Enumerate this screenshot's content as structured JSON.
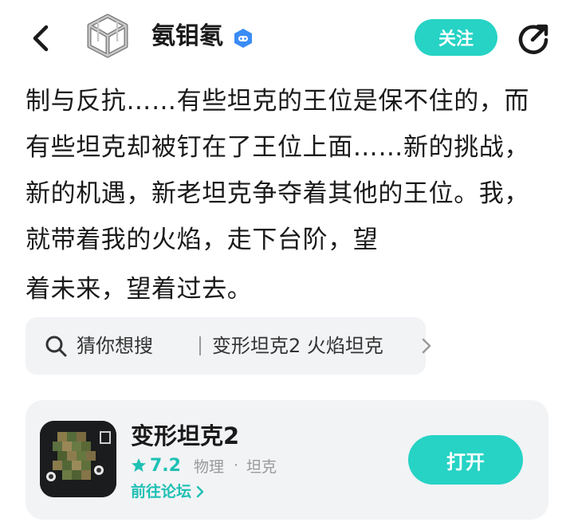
{
  "header": {
    "username": "氨钼氡",
    "follow_label": "关注",
    "back_icon": "chevron-left-icon",
    "share_icon": "share-icon",
    "verified_icon": "verified-badge-icon"
  },
  "article": {
    "paragraph": "制与反抗……有些坦克的王位是保不住的，而有些坦克却被钉在了王位上面……新的挑战，新的机遇，新老坦克争夺着其他的王位。我，就带着我的火焰，走下台阶，望",
    "last_line": "着未来，望着过去。"
  },
  "search_suggestion": {
    "label": "猜你想搜",
    "terms": "变形坦克2 火焰坦克"
  },
  "game_card": {
    "name": "变形坦克2",
    "rating": "7.2",
    "tag1": "物理",
    "separator": "·",
    "tag2": "坦克",
    "forum_link": "前往论坛",
    "open_label": "打开"
  },
  "colors": {
    "accent": "#26d3c5",
    "accent_text": "#1fc0b4",
    "card_bg": "#f2f3f5",
    "verified_blue": "#3a8cf5"
  }
}
